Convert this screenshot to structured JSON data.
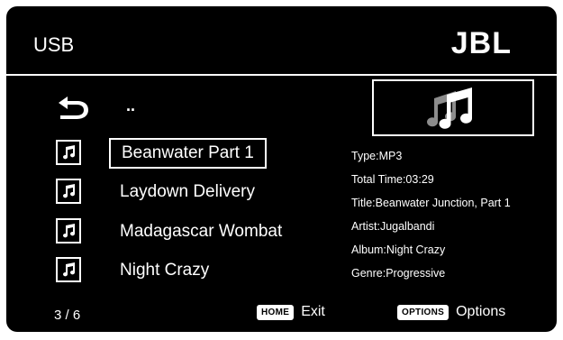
{
  "header": {
    "title": "USB",
    "brand": "JBL"
  },
  "browser": {
    "parent_label": "..",
    "items": [
      {
        "label": "Beanwater Part 1",
        "icon": "music-note-icon",
        "selected": true
      },
      {
        "label": "Laydown Delivery",
        "icon": "music-note-icon",
        "selected": false
      },
      {
        "label": "Madagascar Wombat",
        "icon": "music-note-icon",
        "selected": false
      },
      {
        "label": "Night Crazy",
        "icon": "music-note-icon",
        "selected": false
      }
    ]
  },
  "details": {
    "artwork_icon": "music-notes-icon",
    "lines": [
      "Type:MP3",
      "Total Time:03:29",
      "Title:Beanwater Junction, Part 1",
      "Artist:Jugalbandi",
      "Album:Night Crazy",
      "Genre:Progressive"
    ]
  },
  "footer": {
    "position": "3 / 6",
    "home_key": "HOME",
    "home_label": "Exit",
    "options_key": "OPTIONS",
    "options_label": "Options"
  },
  "colors": {
    "background": "#000000",
    "foreground": "#ffffff"
  }
}
